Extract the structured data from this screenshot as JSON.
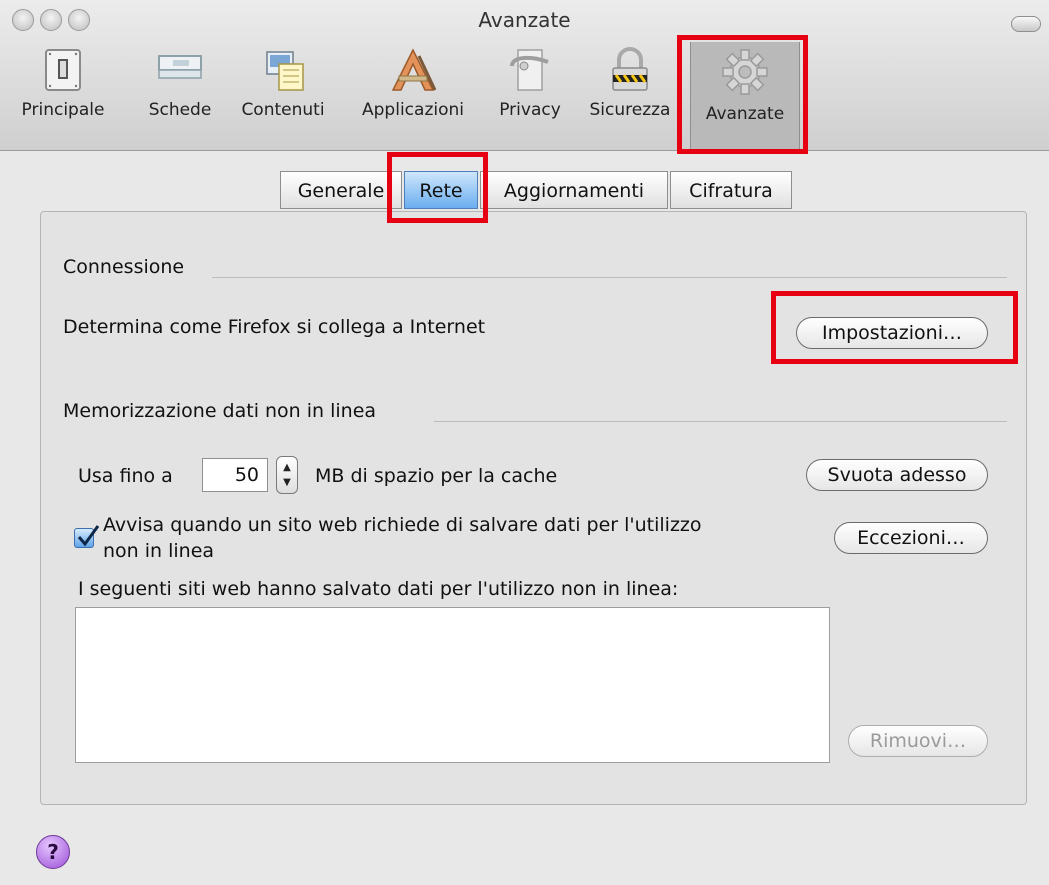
{
  "window": {
    "title": "Avanzate"
  },
  "toolbar": {
    "items": [
      {
        "label": "Principale",
        "icon": "switch-icon"
      },
      {
        "label": "Schede",
        "icon": "tabs-icon"
      },
      {
        "label": "Contenuti",
        "icon": "content-icon"
      },
      {
        "label": "Applicazioni",
        "icon": "applications-icon"
      },
      {
        "label": "Privacy",
        "icon": "door-key-icon"
      },
      {
        "label": "Sicurezza",
        "icon": "padlock-icon"
      },
      {
        "label": "Avanzate",
        "icon": "gear-icon",
        "selected": true
      }
    ]
  },
  "tabs": [
    {
      "label": "Generale"
    },
    {
      "label": "Rete",
      "active": true
    },
    {
      "label": "Aggiornamenti"
    },
    {
      "label": "Cifratura"
    }
  ],
  "connessione": {
    "title": "Connessione",
    "description": "Determina come Firefox si collega a Internet",
    "settings_button": "Impostazioni…"
  },
  "offline": {
    "title": "Memorizzazione dati non in linea",
    "cache_prefix": "Usa fino a",
    "cache_value": "50",
    "cache_suffix": "MB di spazio per la cache",
    "clear_button": "Svuota adesso",
    "warn_label_line1": "Avvisa quando un sito web richiede di salvare dati per l'utilizzo",
    "warn_label_line2": "non in linea",
    "warn_checked": true,
    "exceptions_button": "Eccezioni…",
    "sites_label": "I seguenti siti web hanno salvato dati per l'utilizzo non in linea:",
    "sites": [],
    "remove_button": "Rimuovi…"
  },
  "help": {
    "label": "?"
  },
  "colors": {
    "highlight": "#e60012",
    "active_tab": "#6aaef0"
  }
}
